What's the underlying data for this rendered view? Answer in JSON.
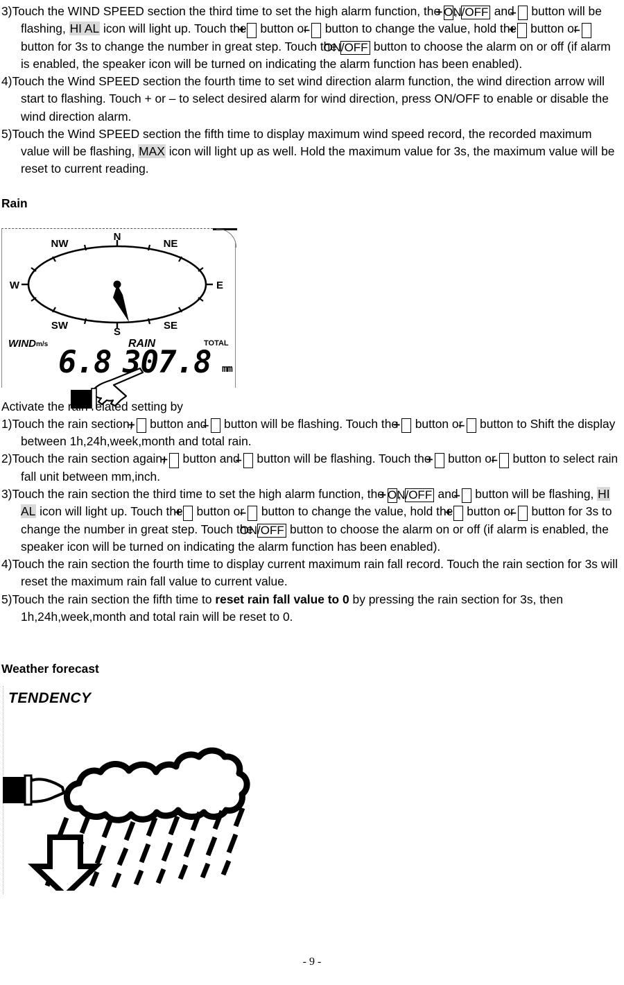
{
  "document": {
    "page_number": "- 9 -"
  },
  "wind_section": {
    "items": [
      {
        "number": "3)",
        "parts": [
          {
            "t": "text",
            "v": "Touch the WIND SPEED section the third time to set the high alarm function, the "
          },
          {
            "t": "key",
            "v": "+"
          },
          {
            "t": "text",
            "v": ", "
          },
          {
            "t": "key",
            "v": "ON/OFF"
          },
          {
            "t": "text",
            "v": " and "
          },
          {
            "t": "key",
            "v": "–"
          },
          {
            "t": "text",
            "v": " button will be flashing, "
          },
          {
            "t": "hl",
            "v": "HI AL"
          },
          {
            "t": "text",
            "v": " icon will light up. Touch the"
          },
          {
            "t": "key",
            "v": "+"
          },
          {
            "t": "text",
            "v": " button or "
          },
          {
            "t": "key",
            "v": "–"
          },
          {
            "t": "text",
            "v": " button to change the value, hold the"
          },
          {
            "t": "key",
            "v": "+"
          },
          {
            "t": "text",
            "v": " button or "
          },
          {
            "t": "key",
            "v": "–"
          },
          {
            "t": "text",
            "v": " button for 3s to change the number in great step. Touch the "
          },
          {
            "t": "key",
            "v": "ON/OFF"
          },
          {
            "t": "text",
            "v": " button to choose the alarm on or off (if alarm is enabled, the speaker icon will be turned on indicating the alarm function has been enabled)."
          }
        ]
      },
      {
        "number": "4)",
        "parts": [
          {
            "t": "text",
            "v": "Touch the Wind SPEED section the fourth time to set wind direction alarm function, the wind direction arrow will start to flashing. Touch + or – to select desired alarm for wind direction, press ON/OFF to enable or disable the wind direction alarm."
          }
        ]
      },
      {
        "number": "5)",
        "parts": [
          {
            "t": "text",
            "v": "Touch the Wind SPEED section the fifth time to display maximum wind speed record, the recorded maximum value will be flashing, "
          },
          {
            "t": "hl",
            "v": "MAX"
          },
          {
            "t": "text",
            "v": " icon will light up as well. Hold the maximum value for 3s, the maximum value will be reset to current reading."
          }
        ]
      }
    ]
  },
  "rain_heading": "Rain",
  "lcd_display": {
    "compass_labels": [
      "N",
      "NE",
      "E",
      "SE",
      "S",
      "SW",
      "W",
      "NW"
    ],
    "wind_label": "WIND",
    "wind_unit": "m/s",
    "wind_value": "6.8",
    "rain_label": "RAIN",
    "rain_value": "307.8",
    "rain_unit": "mm",
    "total_label": "TOTAL",
    "needle_direction": "SSE"
  },
  "rain_section": {
    "intro": "Activate the rain related setting by",
    "items": [
      {
        "number": "1)",
        "parts": [
          {
            "t": "text",
            "v": "Touch the rain section, "
          },
          {
            "t": "key",
            "v": "+"
          },
          {
            "t": "text",
            "v": " button and "
          },
          {
            "t": "key",
            "v": "–"
          },
          {
            "t": "text",
            "v": " button will be flashing. Touch the "
          },
          {
            "t": "key",
            "v": "+"
          },
          {
            "t": "text",
            "v": " button or "
          },
          {
            "t": "key",
            "v": "–"
          },
          {
            "t": "text",
            "v": " button to Shift the display between 1h,24h,week,month and total rain."
          }
        ]
      },
      {
        "number": "2)",
        "parts": [
          {
            "t": "text",
            "v": "Touch the rain section again, "
          },
          {
            "t": "key",
            "v": "+"
          },
          {
            "t": "text",
            "v": " button and "
          },
          {
            "t": "key",
            "v": "–"
          },
          {
            "t": "text",
            "v": " button will be flashing. Touch the "
          },
          {
            "t": "key",
            "v": "+"
          },
          {
            "t": "text",
            "v": " button or "
          },
          {
            "t": "key",
            "v": "–"
          },
          {
            "t": "text",
            "v": " button to select rain fall unit between mm,inch."
          }
        ]
      },
      {
        "number": "3)",
        "parts": [
          {
            "t": "text",
            "v": "Touch the rain section the third time to set the high alarm function, the "
          },
          {
            "t": "key",
            "v": "+"
          },
          {
            "t": "text",
            "v": ", "
          },
          {
            "t": "key",
            "v": "ON/OFF"
          },
          {
            "t": "text",
            "v": " and "
          },
          {
            "t": "key",
            "v": "–"
          },
          {
            "t": "text",
            "v": " button will be flashing, "
          },
          {
            "t": "hl",
            "v": "HI AL"
          },
          {
            "t": "text",
            "v": " icon will light up. Touch the"
          },
          {
            "t": "key",
            "v": "+"
          },
          {
            "t": "text",
            "v": " button or "
          },
          {
            "t": "key",
            "v": "–"
          },
          {
            "t": "text",
            "v": " button to change the value, hold the"
          },
          {
            "t": "key",
            "v": "+"
          },
          {
            "t": "text",
            "v": " button or "
          },
          {
            "t": "key",
            "v": "–"
          },
          {
            "t": "text",
            "v": " button for 3s to change the number in great step. Touch the "
          },
          {
            "t": "key",
            "v": "ON/OFF"
          },
          {
            "t": "text",
            "v": " button to choose the alarm on or off (if alarm is enabled, the speaker icon will be turned on indicating the alarm function has been enabled)."
          }
        ]
      },
      {
        "number": "4)",
        "parts": [
          {
            "t": "text",
            "v": "Touch the rain section the fourth time to display current maximum rain fall record. Touch the rain section for 3s will reset the maximum rain fall value to current value."
          }
        ]
      },
      {
        "number": "5)",
        "parts": [
          {
            "t": "text",
            "v": "Touch the rain section the fifth time to "
          },
          {
            "t": "bold",
            "v": "reset rain fall value to 0"
          },
          {
            "t": "text",
            "v": " by pressing the rain section for 3s, then 1h,24h,week,month and total rain will be reset to 0."
          }
        ]
      }
    ]
  },
  "weather_forecast": {
    "heading": "Weather forecast",
    "tendency_label": "TENDENCY",
    "icon_description": "rainy-cloud-with-falling-rain",
    "arrow_direction": "down"
  }
}
